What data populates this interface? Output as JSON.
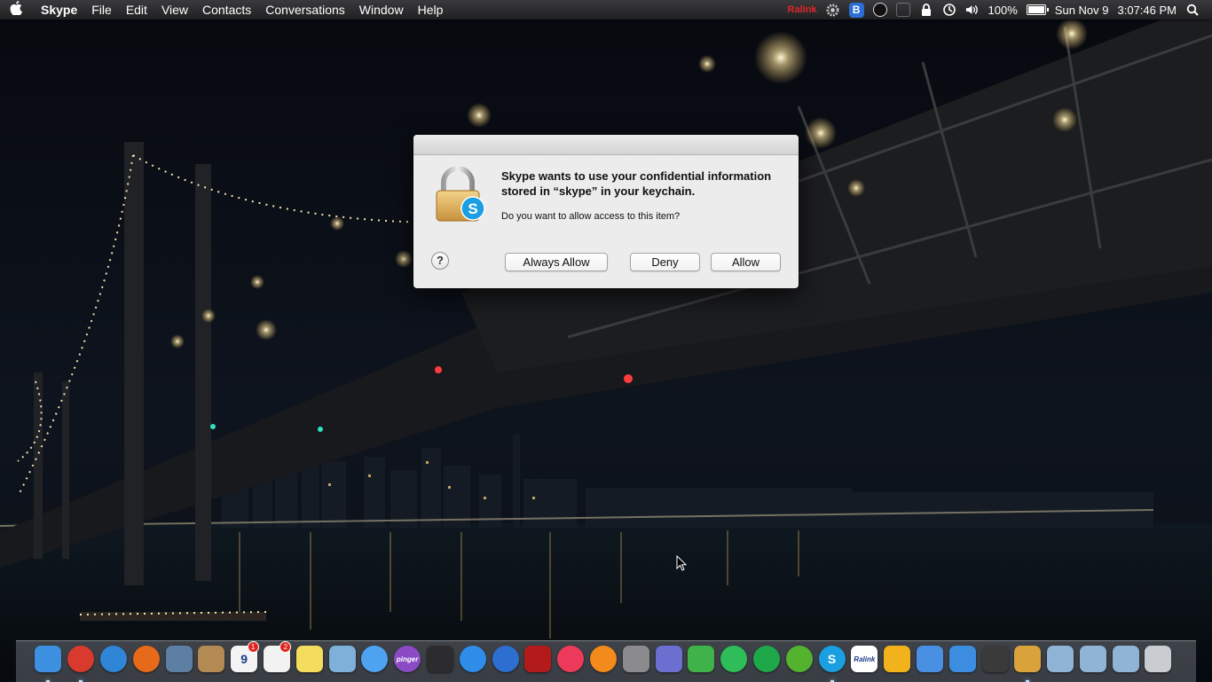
{
  "menubar": {
    "apple_icon": "apple-icon",
    "app_name": "Skype",
    "items": [
      "File",
      "Edit",
      "View",
      "Contacts",
      "Conversations",
      "Window",
      "Help"
    ],
    "status": {
      "ralink": "Ralink",
      "battery_percent": "100%",
      "date": "Sun Nov 9",
      "time": "3:07:46 PM",
      "icons": [
        "gear-icon",
        "b-app-icon",
        "round-app-icon",
        "grey-app-icon",
        "lock-icon",
        "time-machine-icon",
        "volume-icon",
        "battery-icon",
        "spotlight-icon"
      ]
    }
  },
  "dialog": {
    "heading": "Skype wants to use your confidential information stored in “skype” in your keychain.",
    "question": "Do you want to allow access to this item?",
    "help_label": "?",
    "buttons": {
      "always_allow": "Always Allow",
      "deny": "Deny",
      "allow": "Allow"
    }
  },
  "dock": {
    "items": [
      {
        "name": "finder",
        "color": "#3d8fe0",
        "running": true
      },
      {
        "name": "chrome",
        "color": "#d93a2e",
        "running": true
      },
      {
        "name": "safari",
        "color": "#2f86d6",
        "running": false
      },
      {
        "name": "firefox",
        "color": "#e66a1a",
        "running": false
      },
      {
        "name": "preview",
        "color": "#5c7fa3",
        "running": false
      },
      {
        "name": "contacts",
        "color": "#b38a52",
        "running": false
      },
      {
        "name": "calendar",
        "color": "#f4f4f4",
        "label": "9",
        "badge": "1",
        "running": false
      },
      {
        "name": "reminders",
        "color": "#f2f2f2",
        "badge": "2",
        "running": false
      },
      {
        "name": "notes",
        "color": "#f4dc5c",
        "running": false
      },
      {
        "name": "preview-photos",
        "color": "#7fb0d9",
        "running": false
      },
      {
        "name": "messages",
        "color": "#4ea3f0",
        "running": false
      },
      {
        "name": "pinger",
        "color": "#8a4bc4",
        "label": "pinger",
        "running": false
      },
      {
        "name": "facetime",
        "color": "#2c2c2e",
        "running": false
      },
      {
        "name": "app-store",
        "color": "#2f8ce8",
        "running": false
      },
      {
        "name": "itunes-connect",
        "color": "#2d6fd0",
        "running": false
      },
      {
        "name": "photo-booth",
        "color": "#b31b1b",
        "running": false
      },
      {
        "name": "itunes",
        "color": "#ee3a5a",
        "running": false
      },
      {
        "name": "ibooks",
        "color": "#f28a1c",
        "running": false
      },
      {
        "name": "system-preferences",
        "color": "#8b8b8d",
        "running": false
      },
      {
        "name": "wizard-app",
        "color": "#6d6fd0",
        "running": false
      },
      {
        "name": "fairy-app",
        "color": "#3fb24a",
        "running": false
      },
      {
        "name": "spotify",
        "color": "#2ebd59",
        "running": false
      },
      {
        "name": "spotify-alt",
        "color": "#1fa84a",
        "running": false
      },
      {
        "name": "utorrent",
        "color": "#53b32f",
        "running": false
      },
      {
        "name": "skype",
        "color": "#1a9fe0",
        "label": "S",
        "running": true
      },
      {
        "name": "ralink-utility",
        "color": "#ffffff",
        "label": "Ralink",
        "running": false
      },
      {
        "name": "wifi-utility",
        "color": "#f2b21c",
        "running": false
      },
      {
        "name": "xcode-tools",
        "color": "#4a90e2",
        "running": false
      },
      {
        "name": "xcode",
        "color": "#3c8de0",
        "running": false
      },
      {
        "name": "speed-app",
        "color": "#3a3a3a",
        "running": false
      },
      {
        "name": "keychain-access",
        "color": "#d9a23a",
        "running": true
      },
      {
        "name": "applications-folder",
        "color": "#8fb4d6",
        "running": false
      },
      {
        "name": "utilities-folder",
        "color": "#8fb4d6",
        "running": false
      },
      {
        "name": "downloads-folder",
        "color": "#8fb4d6",
        "running": false
      },
      {
        "name": "trash",
        "color": "#c9ccd1",
        "running": false
      }
    ]
  }
}
